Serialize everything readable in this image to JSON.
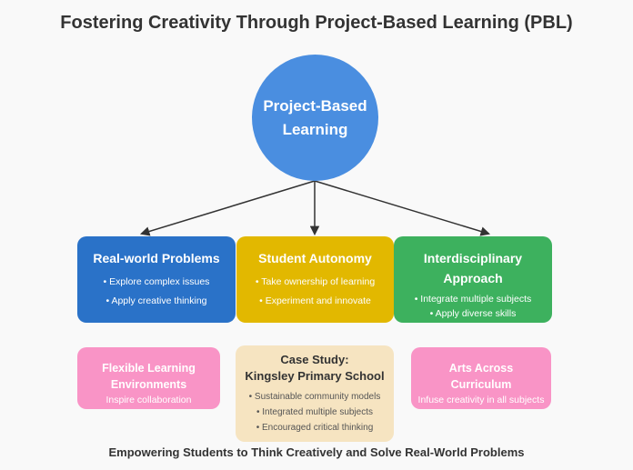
{
  "title": "Fostering Creativity Through Project-Based Learning (PBL)",
  "hub": {
    "line1": "Project-Based",
    "line2": "Learning"
  },
  "real_world": {
    "heading": "Real-world Problems",
    "bullets": [
      "• Explore complex issues",
      "• Apply creative thinking"
    ]
  },
  "autonomy": {
    "heading": "Student Autonomy",
    "bullets": [
      "• Take ownership of learning",
      "• Experiment and innovate"
    ]
  },
  "interdisciplinary": {
    "heading_line1": "Interdisciplinary",
    "heading_line2": "Approach",
    "bullets": [
      "• Integrate multiple subjects",
      "• Apply diverse skills"
    ]
  },
  "flexible": {
    "heading_line1": "Flexible Learning",
    "heading_line2": "Environments",
    "subtitle": "Inspire collaboration"
  },
  "case_study": {
    "heading_line1": "Case Study:",
    "heading_line2": "Kingsley Primary School",
    "bullets": [
      "• Sustainable community models",
      "• Integrated multiple subjects",
      "• Encouraged critical thinking"
    ]
  },
  "arts": {
    "heading_line1": "Arts Across",
    "heading_line2": "Curriculum",
    "subtitle": "Infuse creativity in all subjects"
  },
  "footer": "Empowering Students to Think Creatively and Solve Real-World Problems",
  "colors": {
    "hub": "#4a8ee0",
    "real_world": "#2a72c8",
    "autonomy": "#e2b800",
    "interdisciplinary": "#3db15e",
    "pink": "#f994c6",
    "case_study": "#f6e4c1"
  }
}
